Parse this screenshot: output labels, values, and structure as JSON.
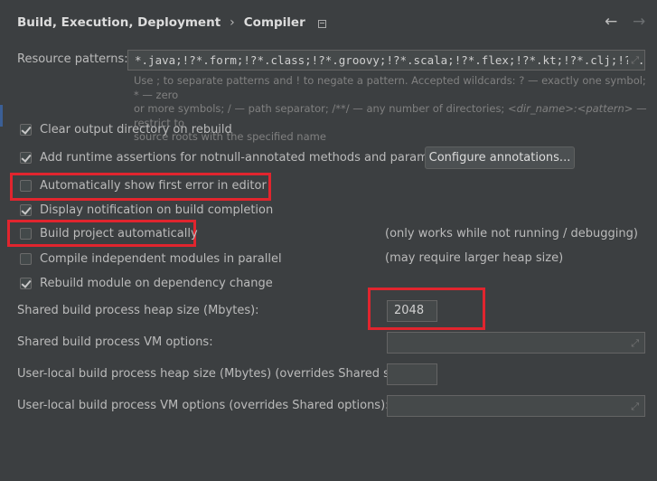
{
  "header": {
    "breadcrumb_parent": "Build, Execution, Deployment",
    "separator": "›",
    "title": "Compiler",
    "back_glyph": "←",
    "forward_glyph": "→"
  },
  "resource_patterns": {
    "label": "Resource patterns:",
    "value": "*.java;!?*.form;!?*.class;!?*.groovy;!?*.scala;!?*.flex;!?*.kt;!?*.clj;!?*.aj",
    "hint_line1": "Use ; to separate patterns and ! to negate a pattern. Accepted wildcards: ? — exactly one symbol; * — zero",
    "hint_line2": "or more symbols; / — path separator; /**/ — any number of directories;",
    "hint_line2_italic": "<dir_name>:<pattern>",
    "hint_line2_tail": "— restrict to",
    "hint_line3": "source roots with the specified name"
  },
  "options": {
    "clear_output": {
      "label": "Clear output directory on rebuild",
      "checked": true
    },
    "runtime_assertions": {
      "label": "Add runtime assertions for notnull-annotated methods and parameters",
      "checked": true
    },
    "configure_annotations": "Configure annotations...",
    "show_first_error": {
      "label": "Automatically show first error in editor",
      "checked": false
    },
    "display_notification": {
      "label": "Display notification on build completion",
      "checked": true
    },
    "build_automatically": {
      "label": "Build project automatically",
      "checked": false,
      "note": "(only works while not running / debugging)"
    },
    "compile_parallel": {
      "label": "Compile independent modules in parallel",
      "checked": false,
      "note": "(may require larger heap size)"
    },
    "rebuild_module": {
      "label": "Rebuild module on dependency change",
      "checked": true
    }
  },
  "fields": {
    "shared_heap": {
      "label": "Shared build process heap size (Mbytes):",
      "value": "2048"
    },
    "shared_vm": {
      "label": "Shared build process VM options:",
      "value": ""
    },
    "user_heap": {
      "label": "User-local build process heap size (Mbytes) (overrides Shared size):",
      "value": ""
    },
    "user_vm": {
      "label": "User-local build process VM options (overrides Shared options):",
      "value": ""
    }
  },
  "colors": {
    "background": "#3c3f41",
    "highlight_box": "#e1252e",
    "field_background": "#45494a"
  }
}
